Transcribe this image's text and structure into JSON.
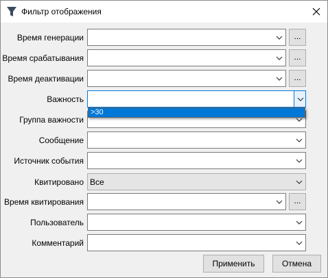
{
  "window": {
    "title": "Фильтр отображения",
    "icon": "funnel-icon",
    "close_icon": "close-icon"
  },
  "fields": [
    {
      "label": "Время генерации",
      "value": "",
      "has_ellipsis": true,
      "ellipsis_label": "..."
    },
    {
      "label": "Время срабатывания",
      "value": "",
      "has_ellipsis": true,
      "ellipsis_label": "..."
    },
    {
      "label": "Время деактивации",
      "value": "",
      "has_ellipsis": true,
      "ellipsis_label": "..."
    },
    {
      "label": "Важность",
      "value": "",
      "has_ellipsis": false,
      "state": "open"
    },
    {
      "label": "Группа важности",
      "value": "",
      "has_ellipsis": false
    },
    {
      "label": "Сообщение",
      "value": "",
      "has_ellipsis": false
    },
    {
      "label": "Источник события",
      "value": "",
      "has_ellipsis": false
    },
    {
      "label": "Квитировано",
      "value": "Все",
      "has_ellipsis": false,
      "state": "readonly"
    },
    {
      "label": "Время квитирования",
      "value": "",
      "has_ellipsis": true,
      "ellipsis_label": "..."
    },
    {
      "label": "Пользователь",
      "value": "",
      "has_ellipsis": false
    },
    {
      "label": "Комментарий",
      "value": "",
      "has_ellipsis": false
    }
  ],
  "importance_dropdown": {
    "options": [
      ">30"
    ],
    "highlighted_index": 0
  },
  "buttons": {
    "apply": "Применить",
    "cancel": "Отмена"
  },
  "colors": {
    "accent": "#0078d7",
    "window_bg": "#f0f0f0",
    "button_bg": "#e1e1e1"
  }
}
